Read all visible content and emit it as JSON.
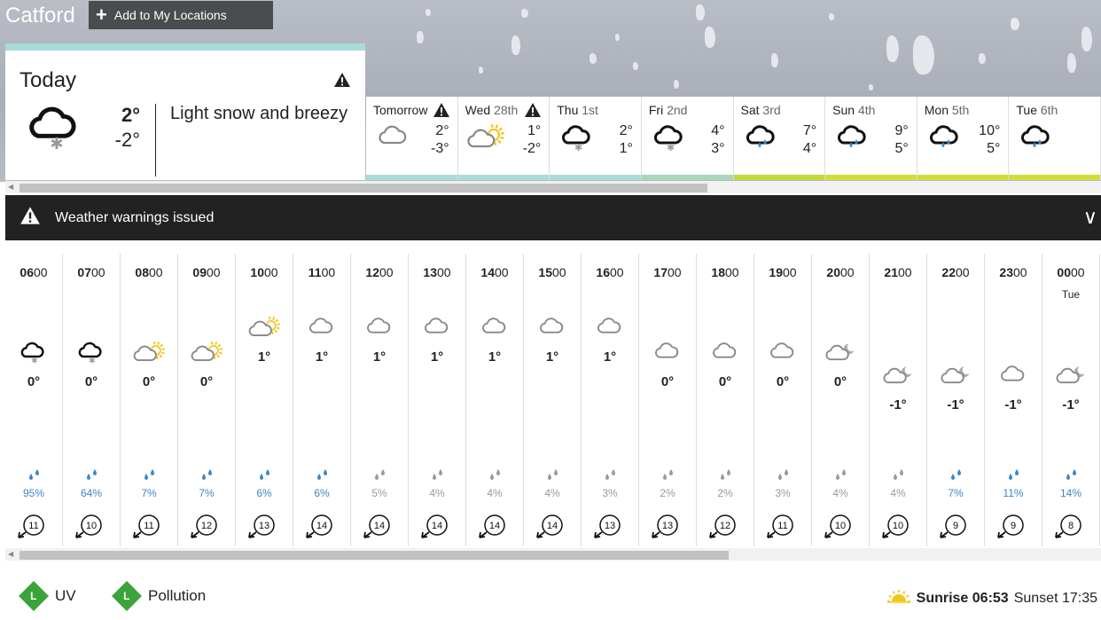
{
  "header": {
    "location": "Catford",
    "add_label": "Add to My Locations",
    "add_icon": "plus-icon"
  },
  "today": {
    "label": "Today",
    "high": "2°",
    "low": "-2°",
    "description": "Light snow and breezy",
    "icon": "light-snow-icon",
    "warning": true
  },
  "days": [
    {
      "name": "Tomorrow",
      "date": "",
      "high": "2°",
      "low": "-3°",
      "icon": "cloud-icon",
      "warning": true,
      "bar_color": "#a7dcd9"
    },
    {
      "name": "Wed",
      "date": "28th",
      "high": "1°",
      "low": "-2°",
      "icon": "sunny-intervals-icon",
      "warning": true,
      "bar_color": "#a7dcd9"
    },
    {
      "name": "Thu",
      "date": "1st",
      "high": "2°",
      "low": "1°",
      "icon": "light-snow-icon",
      "warning": false,
      "bar_color": "#a7dcd9"
    },
    {
      "name": "Fri",
      "date": "2nd",
      "high": "4°",
      "low": "3°",
      "icon": "light-snow-icon",
      "warning": false,
      "bar_color": "#a8d8b8"
    },
    {
      "name": "Sat",
      "date": "3rd",
      "high": "7°",
      "low": "4°",
      "icon": "light-rain-icon",
      "warning": false,
      "bar_color": "#c3d93a"
    },
    {
      "name": "Sun",
      "date": "4th",
      "high": "9°",
      "low": "5°",
      "icon": "light-rain-icon",
      "warning": false,
      "bar_color": "#d4dc36"
    },
    {
      "name": "Mon",
      "date": "5th",
      "high": "10°",
      "low": "5°",
      "icon": "light-rain-icon",
      "warning": false,
      "bar_color": "#d4dc36"
    },
    {
      "name": "Tue",
      "date": "6th",
      "high": "",
      "low": "",
      "icon": "light-rain-icon",
      "warning": false,
      "bar_color": "#d4dc36"
    }
  ],
  "warning_bar": {
    "label": "Weather warnings issued"
  },
  "hours": [
    {
      "hh": "06",
      "mm": "00",
      "sub": "",
      "icon": "light-snow-icon",
      "temp": "0°",
      "rain": "95%",
      "rain_color": "#3a87c8",
      "wind": "11"
    },
    {
      "hh": "07",
      "mm": "00",
      "sub": "",
      "icon": "light-snow-icon",
      "temp": "0°",
      "rain": "64%",
      "rain_color": "#3a87c8",
      "wind": "10"
    },
    {
      "hh": "08",
      "mm": "00",
      "sub": "",
      "icon": "sunny-intervals-icon",
      "temp": "0°",
      "rain": "7%",
      "rain_color": "#3a87c8",
      "wind": "11"
    },
    {
      "hh": "09",
      "mm": "00",
      "sub": "",
      "icon": "sunny-intervals-icon",
      "temp": "0°",
      "rain": "7%",
      "rain_color": "#3a87c8",
      "wind": "12"
    },
    {
      "hh": "10",
      "mm": "00",
      "sub": "",
      "icon": "sunny-intervals-icon",
      "temp": "1°",
      "rain": "6%",
      "rain_color": "#3a87c8",
      "wind": "13"
    },
    {
      "hh": "11",
      "mm": "00",
      "sub": "",
      "icon": "cloud-icon",
      "temp": "1°",
      "rain": "6%",
      "rain_color": "#3a87c8",
      "wind": "14"
    },
    {
      "hh": "12",
      "mm": "00",
      "sub": "",
      "icon": "cloud-icon",
      "temp": "1°",
      "rain": "5%",
      "rain_color": "#888888",
      "wind": "14"
    },
    {
      "hh": "13",
      "mm": "00",
      "sub": "",
      "icon": "cloud-icon",
      "temp": "1°",
      "rain": "4%",
      "rain_color": "#888888",
      "wind": "14"
    },
    {
      "hh": "14",
      "mm": "00",
      "sub": "",
      "icon": "cloud-icon",
      "temp": "1°",
      "rain": "4%",
      "rain_color": "#888888",
      "wind": "14"
    },
    {
      "hh": "15",
      "mm": "00",
      "sub": "",
      "icon": "cloud-icon",
      "temp": "1°",
      "rain": "4%",
      "rain_color": "#888888",
      "wind": "14"
    },
    {
      "hh": "16",
      "mm": "00",
      "sub": "",
      "icon": "cloud-icon",
      "temp": "1°",
      "rain": "3%",
      "rain_color": "#888888",
      "wind": "13"
    },
    {
      "hh": "17",
      "mm": "00",
      "sub": "",
      "icon": "cloud-icon",
      "temp": "0°",
      "rain": "2%",
      "rain_color": "#888888",
      "wind": "13"
    },
    {
      "hh": "18",
      "mm": "00",
      "sub": "",
      "icon": "cloud-icon",
      "temp": "0°",
      "rain": "2%",
      "rain_color": "#888888",
      "wind": "12"
    },
    {
      "hh": "19",
      "mm": "00",
      "sub": "",
      "icon": "cloud-icon",
      "temp": "0°",
      "rain": "3%",
      "rain_color": "#888888",
      "wind": "11"
    },
    {
      "hh": "20",
      "mm": "00",
      "sub": "",
      "icon": "cloud-moon-icon",
      "temp": "0°",
      "rain": "4%",
      "rain_color": "#888888",
      "wind": "10"
    },
    {
      "hh": "21",
      "mm": "00",
      "sub": "",
      "icon": "cloud-moon-icon",
      "temp": "-1°",
      "rain": "4%",
      "rain_color": "#888888",
      "wind": "10"
    },
    {
      "hh": "22",
      "mm": "00",
      "sub": "",
      "icon": "cloud-moon-icon",
      "temp": "-1°",
      "rain": "7%",
      "rain_color": "#3a87c8",
      "wind": "9"
    },
    {
      "hh": "23",
      "mm": "00",
      "sub": "",
      "icon": "cloud-icon",
      "temp": "-1°",
      "rain": "11%",
      "rain_color": "#3a87c8",
      "wind": "9"
    },
    {
      "hh": "00",
      "mm": "00",
      "sub": "Tue",
      "icon": "cloud-moon-icon",
      "temp": "-1°",
      "rain": "14%",
      "rain_color": "#3a87c8",
      "wind": "8"
    }
  ],
  "footer": {
    "uv_level": "L",
    "uv_label": "UV",
    "pollution_level": "L",
    "pollution_label": "Pollution",
    "sunrise_label": "Sunrise 06:53",
    "sunset_label": "Sunset 17:35"
  },
  "colors": {
    "accent_rain": "#3a87c8",
    "sun": "#f5c518",
    "badge_green": "#3aa33a"
  }
}
